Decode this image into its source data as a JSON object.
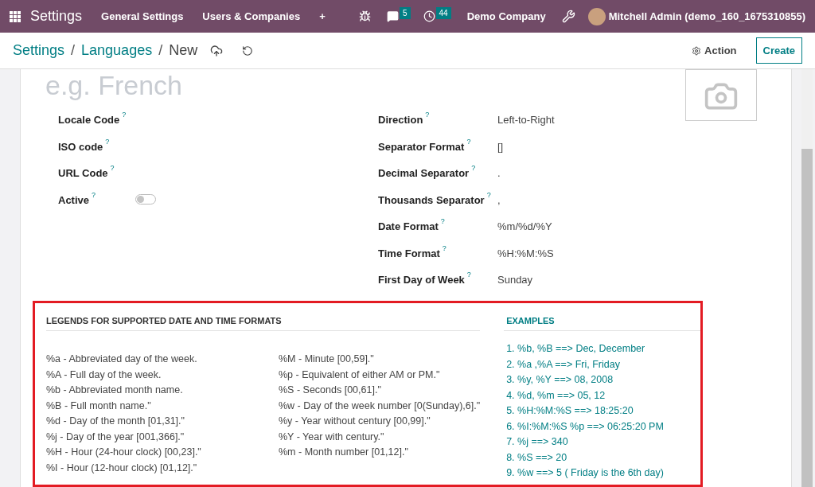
{
  "navbar": {
    "app": "Settings",
    "menus": [
      "General Settings",
      "Users & Companies",
      "+"
    ],
    "messages_count": "5",
    "activities_count": "44",
    "company": "Demo Company",
    "user": "Mitchell Admin (demo_160_1675310855)"
  },
  "breadcrumb": [
    {
      "kind": "link",
      "text": "Settings"
    },
    {
      "kind": "separator",
      "text": "/"
    },
    {
      "kind": "link",
      "text": "Languages"
    },
    {
      "kind": "separator",
      "text": "/"
    },
    {
      "kind": "current",
      "text": "New"
    }
  ],
  "actions": {
    "action": "Action",
    "create": "Create"
  },
  "form": {
    "name_placeholder": "e.g. French",
    "left_fields": [
      {
        "label": "Locale Code",
        "hint": "?",
        "kind": "text"
      },
      {
        "label": "ISO code",
        "hint": "?",
        "kind": "text"
      },
      {
        "label": "URL Code",
        "hint": "?",
        "kind": "text"
      },
      {
        "label": "Active",
        "hint": "?",
        "kind": "toggle",
        "on": false
      }
    ],
    "right_fields": [
      {
        "label": "Direction",
        "hint": "?",
        "value": "Left-to-Right"
      },
      {
        "label": "Separator Format",
        "hint": "?",
        "value": "[]"
      },
      {
        "label": "Decimal Separator",
        "hint": "?",
        "value": "."
      },
      {
        "label": "Thousands Separator",
        "hint": "?",
        "value": ","
      },
      {
        "label": "Date Format",
        "hint": "?",
        "value": "%m/%d/%Y"
      },
      {
        "label": "Time Format",
        "hint": "?",
        "value": "%H:%M:%S"
      },
      {
        "label": "First Day of Week",
        "hint": "?",
        "value": "Sunday"
      }
    ]
  },
  "legends": {
    "title": "LEGENDS FOR SUPPORTED DATE AND TIME FORMATS",
    "column_1": [
      "%a - Abbreviated day of the week.",
      "%A - Full day of the week.",
      "%b - Abbreviated month name.",
      "%B - Full month name.\"",
      "%d - Day of the month [01,31].\"",
      "%j - Day of the year [001,366].\"",
      "%H - Hour (24-hour clock) [00,23].\"",
      "%I - Hour (12-hour clock) [01,12].\""
    ],
    "column_2": [
      "%M - Minute [00,59].\"",
      "%p - Equivalent of either AM or PM.\"",
      "%S - Seconds [00,61].\"",
      "%w - Day of the week number [0(Sunday),6].\"",
      "%y - Year without century [00,99].\"",
      "%Y - Year with century.\"",
      "%m - Month number [01,12].\""
    ]
  },
  "examples": {
    "title": "EXAMPLES",
    "items": [
      "1. %b, %B ==> Dec, December",
      "2. %a ,%A ==> Fri, Friday",
      "3. %y, %Y ==> 08, 2008",
      "4. %d, %m ==> 05, 12",
      "5. %H:%M:%S ==> 18:25:20",
      "6. %I:%M:%S %p ==> 06:25:20 PM",
      "7. %j ==> 340",
      "8. %S ==> 20",
      "9. %w ==> 5 ( Friday is the 6th day)"
    ]
  }
}
